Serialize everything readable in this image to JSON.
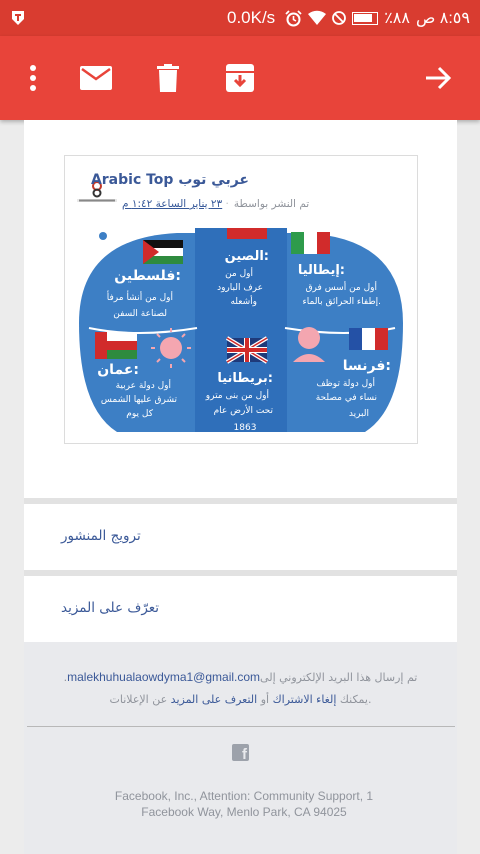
{
  "status_bar": {
    "time": "٨:٥٩ ص",
    "battery": "٪٨٨",
    "net_speed": "0.0K/s",
    "icons": [
      "app-notification-icon",
      "alarm-icon",
      "wifi-icon",
      "no-sim-icon",
      "battery-icon"
    ]
  },
  "toolbar": {
    "actions": [
      "overflow-menu-icon",
      "mark-unread-icon",
      "delete-icon",
      "archive-icon",
      "forward-arrow-icon"
    ]
  },
  "post": {
    "author": "عربي توب Arabic Top",
    "posted_by": "تم النشر بواسطة",
    "date": "٢٣ يناير الساعة ١:٤٢ م",
    "image": {
      "countries": [
        {
          "name": "فلسطين:",
          "text1": "أول من أنشأ مرفأ",
          "text2": "لصناعة السفن"
        },
        {
          "name": "الصين:",
          "text1": "أول من",
          "text2": "عرف البارود",
          "text3": "وأشعله"
        },
        {
          "name": "إيطاليا:",
          "text1": "أول من أسس فرق",
          "text2": "إطفاء الحرائق بالماء."
        },
        {
          "name": "عمان:",
          "text1": "أول دولة عربية",
          "text2": "تشرق عليها الشمس",
          "text3": "كل يوم"
        },
        {
          "name": "بريطانيا:",
          "text1": "أول من بنى مترو",
          "text2": "تحت الأرض عام",
          "text3": "1863"
        },
        {
          "name": "فرنسا:",
          "text1": "أول دولة توظف",
          "text2": "نساء في مصلحة",
          "text3": "البريد"
        }
      ]
    }
  },
  "links": {
    "promote": "ترويج المنشور",
    "learn_more": "تعرّف على المزيد"
  },
  "footer": {
    "sent_to": "تم إرسال هذا البريد الإلكتروني إلى",
    "email": "malekhuhualaowdyma1@gmail.com",
    "period": ".",
    "you_can": ".يمكنك",
    "unsubscribe": "إلغاء الاشتراك",
    "or": "أو",
    "learn_more": "التعرف على المزيد",
    "about_ads": "عن الإعلانات",
    "address_line1": "Facebook, Inc., Attention: Community Support, 1",
    "address_line2": "Facebook Way, Menlo Park, CA 94025"
  },
  "colors": {
    "toolbar": "#e8443a",
    "status_bar": "#d93c30",
    "link": "#3b5998",
    "infographic_bg": "#3d7fc5"
  }
}
